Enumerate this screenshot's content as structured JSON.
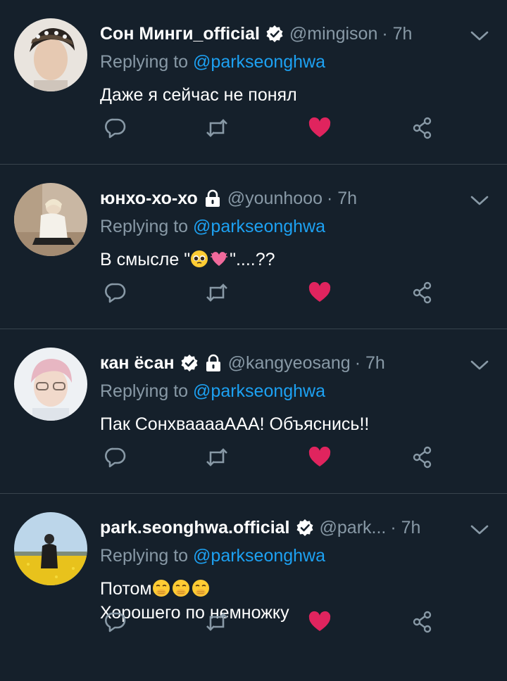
{
  "tweets": [
    {
      "name": "Сон Минги_official",
      "verified": true,
      "locked": false,
      "handle": "@mingison",
      "time": "· 7h",
      "reply_prefix": "Replying to ",
      "reply_to": "@parkseonghwa",
      "lines": [
        "Даже я сейчас не понял"
      ],
      "liked": true
    },
    {
      "name": "юнхо-хо-хо",
      "verified": false,
      "locked": true,
      "handle": "@younhooo",
      "time": "· 7h",
      "reply_prefix": "Replying to ",
      "reply_to": "@parkseonghwa",
      "lines": [
        "В смысле \"",
        "\"....??"
      ],
      "liked": true
    },
    {
      "name": "кан ёсан",
      "verified": true,
      "locked": true,
      "handle": "@kangyeosang",
      "time": "· 7h",
      "reply_prefix": "Replying to ",
      "reply_to": "@parkseonghwa",
      "lines": [
        "Пак СонхваaaaAAA! Объяснись!!"
      ],
      "liked": true
    },
    {
      "name": "park.seonghwa.official",
      "verified": true,
      "locked": false,
      "handle": "@park...",
      "time": "· 7h",
      "reply_prefix": "Replying to ",
      "reply_to": "@parkseonghwa",
      "lines": [
        "Потом",
        "Хорошего по немножку"
      ],
      "liked": true
    }
  ],
  "colors": {
    "background": "#15202b",
    "muted": "#8899a6",
    "link": "#1da1f2",
    "like": "#e0245e",
    "divider": "#38444d"
  },
  "icons": [
    "verified-badge-icon",
    "lock-icon",
    "chevron-down-icon",
    "reply-icon",
    "retweet-icon",
    "heart-icon",
    "share-icon"
  ]
}
